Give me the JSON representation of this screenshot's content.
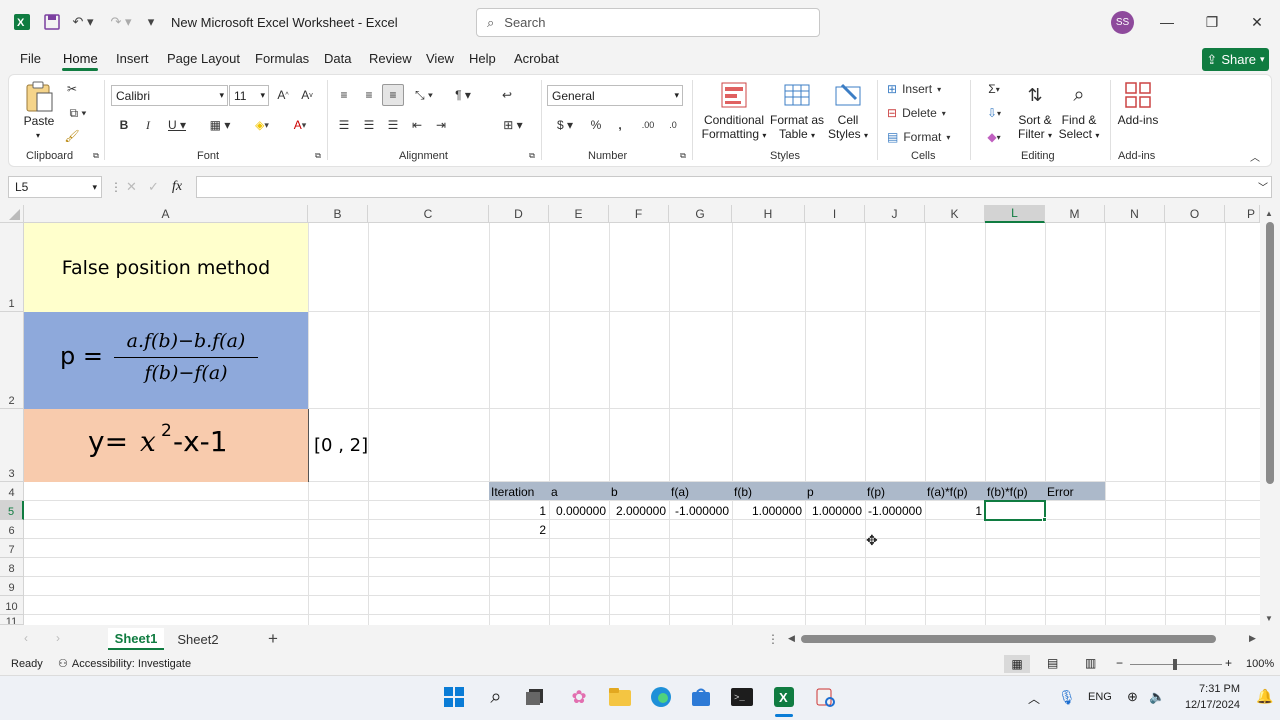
{
  "window": {
    "title": "New Microsoft Excel Worksheet  -  Excel",
    "search_placeholder": "Search",
    "avatar_initials": "SS"
  },
  "menu": {
    "items": [
      "File",
      "Home",
      "Insert",
      "Page Layout",
      "Formulas",
      "Data",
      "Review",
      "View",
      "Help",
      "Acrobat"
    ],
    "share_label": "Share"
  },
  "ribbon": {
    "clipboard": {
      "paste": "Paste",
      "label": "Clipboard"
    },
    "font": {
      "name": "Calibri",
      "size": "11",
      "label": "Font"
    },
    "alignment": {
      "label": "Alignment"
    },
    "number": {
      "format": "General",
      "label": "Number"
    },
    "styles": {
      "conditional": "Conditional",
      "conditional2": "Formatting",
      "format_as": "Format as",
      "format_as2": "Table",
      "cell": "Cell",
      "cell2": "Styles",
      "label": "Styles"
    },
    "cells": {
      "insert": "Insert",
      "delete": "Delete",
      "format": "Format",
      "label": "Cells"
    },
    "editing": {
      "sort": "Sort &",
      "sort2": "Filter",
      "find": "Find &",
      "find2": "Select",
      "label": "Editing"
    },
    "addins": {
      "button": "Add-ins",
      "label": "Add-ins"
    }
  },
  "formula_bar": {
    "name_box": "L5",
    "fx": "fx",
    "value": ""
  },
  "columns": [
    "A",
    "B",
    "C",
    "D",
    "E",
    "F",
    "G",
    "H",
    "I",
    "J",
    "K",
    "L",
    "M",
    "N",
    "O",
    "P"
  ],
  "rows": [
    "1",
    "2",
    "3",
    "4",
    "5",
    "6",
    "7",
    "8",
    "9",
    "10",
    "11"
  ],
  "cells": {
    "a1": "False position method",
    "a2_lhs": "p =",
    "a2_num": "a.f(b)−b.f(a)",
    "a2_den": "f(b)−f(a)",
    "a3_y": "y=",
    "a3_x": "x",
    "a3_exp": "2",
    "a3_rest": "-x-1",
    "b3": "[0 , 2]",
    "headers": [
      "Iteration",
      "a",
      "b",
      "f(a)",
      "f(b)",
      "p",
      "f(p)",
      "f(a)*f(p)",
      "f(b)*f(p)",
      "Error"
    ],
    "row5": [
      "1",
      "0.000000",
      "2.000000",
      "-1.000000",
      "1.000000",
      "1.000000",
      "-1.000000",
      "1"
    ],
    "d6": "2"
  },
  "sheets": [
    "Sheet1",
    "Sheet2"
  ],
  "status": {
    "ready": "Ready",
    "accessibility": "Accessibility: Investigate",
    "zoom": "100%"
  },
  "taskbar": {
    "lang": "ENG",
    "time": "7:31 PM",
    "date": "12/17/2024"
  },
  "colors": {
    "excel_green": "#107c41",
    "a1_fill": "#ffffcc",
    "a2_fill": "#8ea9db",
    "a3_fill": "#f8cbad",
    "header_fill": "#acb9ca"
  }
}
